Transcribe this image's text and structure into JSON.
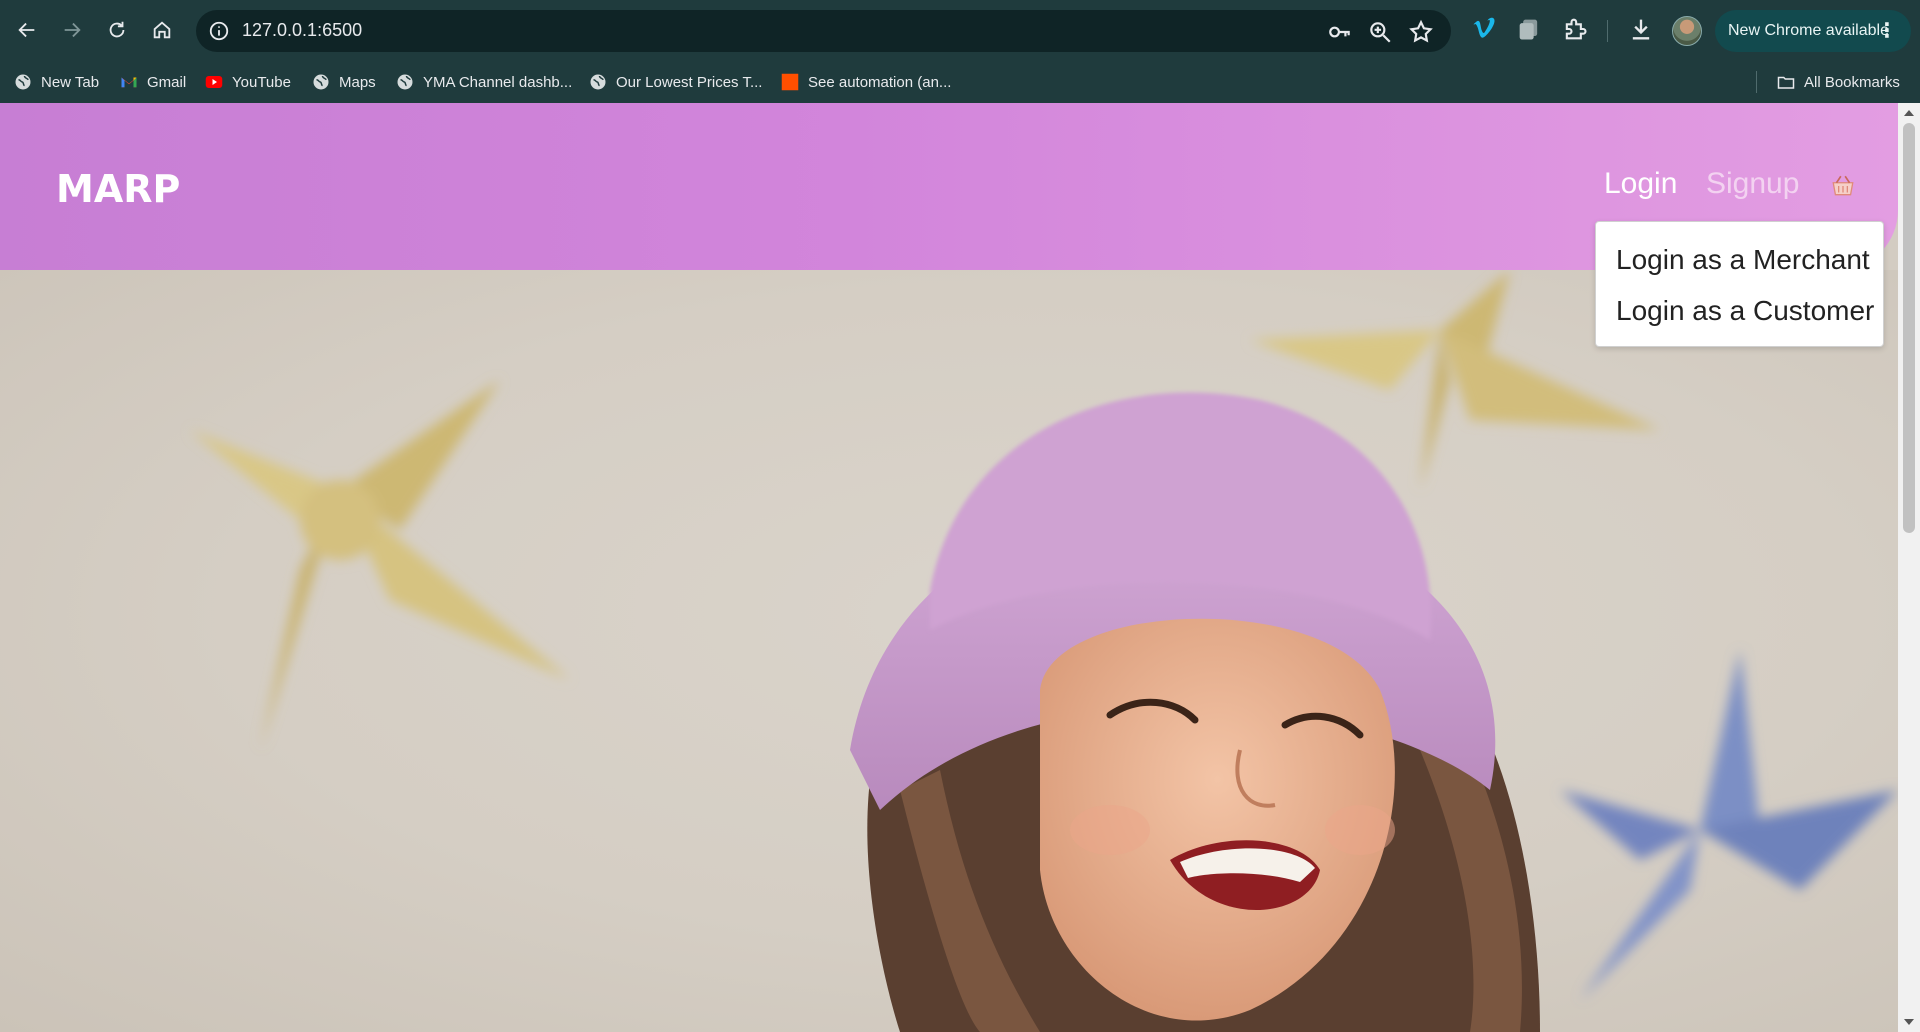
{
  "browser": {
    "url": "127.0.0.1:6500",
    "new_chrome_label": "New Chrome available",
    "menu_glyph": "⋮",
    "bookmarks": [
      {
        "label": "New Tab",
        "icon": "globe-icon"
      },
      {
        "label": "Gmail",
        "icon": "gmail-icon"
      },
      {
        "label": "YouTube",
        "icon": "youtube-icon"
      },
      {
        "label": "Maps",
        "icon": "globe-icon"
      },
      {
        "label": "YMA Channel dashb...",
        "icon": "globe-icon"
      },
      {
        "label": "Our Lowest Prices T...",
        "icon": "globe-icon"
      },
      {
        "label": "See automation (an...",
        "icon": "orange-square-icon"
      }
    ],
    "all_bookmarks_label": "All Bookmarks"
  },
  "site": {
    "logo_text": "MARP",
    "nav": {
      "login": "Login",
      "signup": "Signup"
    },
    "login_dropdown": [
      "Login as a Merchant",
      "Login as a Customer"
    ]
  },
  "colors": {
    "header_start": "#c77ed4",
    "header_end": "#e39de2",
    "chrome_frame": "#1f3b3d",
    "hero_bg": "#d3ccc2"
  }
}
